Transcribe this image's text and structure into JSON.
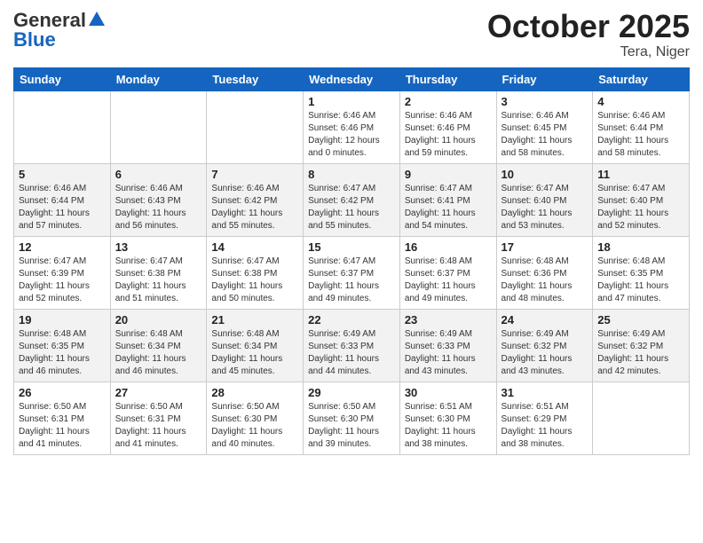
{
  "header": {
    "logo_general": "General",
    "logo_blue": "Blue",
    "month": "October 2025",
    "location": "Tera, Niger"
  },
  "days_of_week": [
    "Sunday",
    "Monday",
    "Tuesday",
    "Wednesday",
    "Thursday",
    "Friday",
    "Saturday"
  ],
  "weeks": [
    [
      {
        "day": "",
        "info": ""
      },
      {
        "day": "",
        "info": ""
      },
      {
        "day": "",
        "info": ""
      },
      {
        "day": "1",
        "info": "Sunrise: 6:46 AM\nSunset: 6:46 PM\nDaylight: 12 hours and 0 minutes."
      },
      {
        "day": "2",
        "info": "Sunrise: 6:46 AM\nSunset: 6:46 PM\nDaylight: 11 hours and 59 minutes."
      },
      {
        "day": "3",
        "info": "Sunrise: 6:46 AM\nSunset: 6:45 PM\nDaylight: 11 hours and 58 minutes."
      },
      {
        "day": "4",
        "info": "Sunrise: 6:46 AM\nSunset: 6:44 PM\nDaylight: 11 hours and 58 minutes."
      }
    ],
    [
      {
        "day": "5",
        "info": "Sunrise: 6:46 AM\nSunset: 6:44 PM\nDaylight: 11 hours and 57 minutes."
      },
      {
        "day": "6",
        "info": "Sunrise: 6:46 AM\nSunset: 6:43 PM\nDaylight: 11 hours and 56 minutes."
      },
      {
        "day": "7",
        "info": "Sunrise: 6:46 AM\nSunset: 6:42 PM\nDaylight: 11 hours and 55 minutes."
      },
      {
        "day": "8",
        "info": "Sunrise: 6:47 AM\nSunset: 6:42 PM\nDaylight: 11 hours and 55 minutes."
      },
      {
        "day": "9",
        "info": "Sunrise: 6:47 AM\nSunset: 6:41 PM\nDaylight: 11 hours and 54 minutes."
      },
      {
        "day": "10",
        "info": "Sunrise: 6:47 AM\nSunset: 6:40 PM\nDaylight: 11 hours and 53 minutes."
      },
      {
        "day": "11",
        "info": "Sunrise: 6:47 AM\nSunset: 6:40 PM\nDaylight: 11 hours and 52 minutes."
      }
    ],
    [
      {
        "day": "12",
        "info": "Sunrise: 6:47 AM\nSunset: 6:39 PM\nDaylight: 11 hours and 52 minutes."
      },
      {
        "day": "13",
        "info": "Sunrise: 6:47 AM\nSunset: 6:38 PM\nDaylight: 11 hours and 51 minutes."
      },
      {
        "day": "14",
        "info": "Sunrise: 6:47 AM\nSunset: 6:38 PM\nDaylight: 11 hours and 50 minutes."
      },
      {
        "day": "15",
        "info": "Sunrise: 6:47 AM\nSunset: 6:37 PM\nDaylight: 11 hours and 49 minutes."
      },
      {
        "day": "16",
        "info": "Sunrise: 6:48 AM\nSunset: 6:37 PM\nDaylight: 11 hours and 49 minutes."
      },
      {
        "day": "17",
        "info": "Sunrise: 6:48 AM\nSunset: 6:36 PM\nDaylight: 11 hours and 48 minutes."
      },
      {
        "day": "18",
        "info": "Sunrise: 6:48 AM\nSunset: 6:35 PM\nDaylight: 11 hours and 47 minutes."
      }
    ],
    [
      {
        "day": "19",
        "info": "Sunrise: 6:48 AM\nSunset: 6:35 PM\nDaylight: 11 hours and 46 minutes."
      },
      {
        "day": "20",
        "info": "Sunrise: 6:48 AM\nSunset: 6:34 PM\nDaylight: 11 hours and 46 minutes."
      },
      {
        "day": "21",
        "info": "Sunrise: 6:48 AM\nSunset: 6:34 PM\nDaylight: 11 hours and 45 minutes."
      },
      {
        "day": "22",
        "info": "Sunrise: 6:49 AM\nSunset: 6:33 PM\nDaylight: 11 hours and 44 minutes."
      },
      {
        "day": "23",
        "info": "Sunrise: 6:49 AM\nSunset: 6:33 PM\nDaylight: 11 hours and 43 minutes."
      },
      {
        "day": "24",
        "info": "Sunrise: 6:49 AM\nSunset: 6:32 PM\nDaylight: 11 hours and 43 minutes."
      },
      {
        "day": "25",
        "info": "Sunrise: 6:49 AM\nSunset: 6:32 PM\nDaylight: 11 hours and 42 minutes."
      }
    ],
    [
      {
        "day": "26",
        "info": "Sunrise: 6:50 AM\nSunset: 6:31 PM\nDaylight: 11 hours and 41 minutes."
      },
      {
        "day": "27",
        "info": "Sunrise: 6:50 AM\nSunset: 6:31 PM\nDaylight: 11 hours and 41 minutes."
      },
      {
        "day": "28",
        "info": "Sunrise: 6:50 AM\nSunset: 6:30 PM\nDaylight: 11 hours and 40 minutes."
      },
      {
        "day": "29",
        "info": "Sunrise: 6:50 AM\nSunset: 6:30 PM\nDaylight: 11 hours and 39 minutes."
      },
      {
        "day": "30",
        "info": "Sunrise: 6:51 AM\nSunset: 6:30 PM\nDaylight: 11 hours and 38 minutes."
      },
      {
        "day": "31",
        "info": "Sunrise: 6:51 AM\nSunset: 6:29 PM\nDaylight: 11 hours and 38 minutes."
      },
      {
        "day": "",
        "info": ""
      }
    ]
  ]
}
